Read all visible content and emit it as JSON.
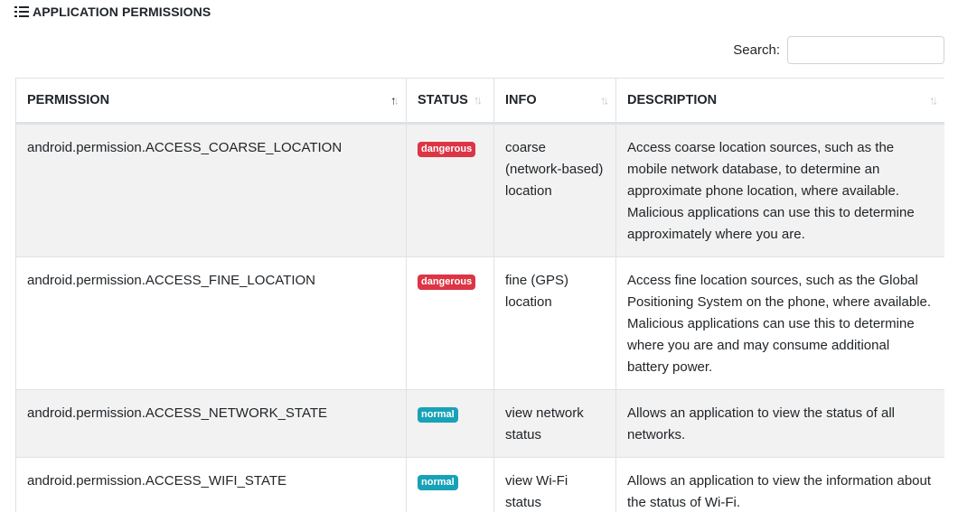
{
  "section": {
    "title": "APPLICATION PERMISSIONS",
    "icon": "list-icon"
  },
  "search": {
    "label": "Search:",
    "value": "",
    "placeholder": ""
  },
  "table": {
    "headers": {
      "permission": "PERMISSION",
      "status": "STATUS",
      "info": "INFO",
      "description": "DESCRIPTION"
    },
    "rows": [
      {
        "permission": "android.permission.ACCESS_COARSE_LOCATION",
        "status": "dangerous",
        "info": "coarse (network-based) location",
        "description": "Access coarse location sources, such as the mobile network database, to determine an approximate phone location, where available. Malicious applications can use this to determine approximately where you are."
      },
      {
        "permission": "android.permission.ACCESS_FINE_LOCATION",
        "status": "dangerous",
        "info": "fine (GPS) location",
        "description": "Access fine location sources, such as the Global Positioning System on the phone, where available. Malicious applications can use this to determine where you are and may consume additional battery power."
      },
      {
        "permission": "android.permission.ACCESS_NETWORK_STATE",
        "status": "normal",
        "info": "view network status",
        "description": "Allows an application to view the status of all networks."
      },
      {
        "permission": "android.permission.ACCESS_WIFI_STATE",
        "status": "normal",
        "info": "view Wi-Fi status",
        "description": "Allows an application to view the information about the status of Wi-Fi."
      }
    ]
  },
  "colors": {
    "dangerous": "#dc3545",
    "normal": "#17a2b8",
    "stripe": "#f2f2f2",
    "border": "#dee2e6"
  }
}
